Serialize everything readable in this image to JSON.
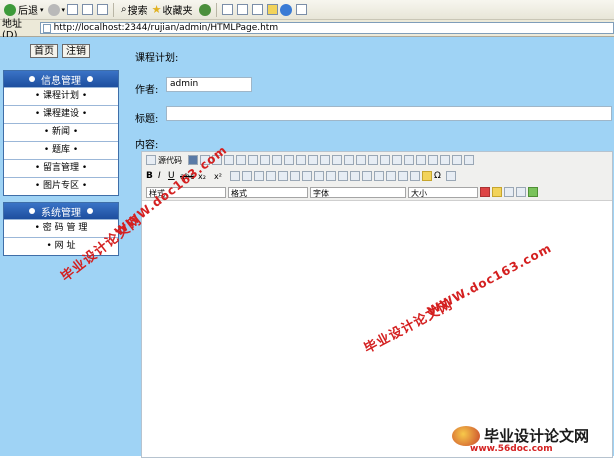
{
  "browser": {
    "toolbar": {
      "back_label": "后退",
      "search_label": "搜索",
      "favorites_label": "收藏夹"
    },
    "address": {
      "label": "地址(D)",
      "url": "http://localhost:2344/rujian/admin/HTMLPage.htm"
    }
  },
  "sidebar": {
    "home_button": "首页",
    "logout_button": "注销",
    "info_menu": {
      "title": "信息管理",
      "items": [
        "• 课程计划 •",
        "• 课程建设 •",
        "• 新闻 •",
        "• 题库 •",
        "• 留言管理 •",
        "• 图片专区 •"
      ]
    },
    "system_menu": {
      "title": "系统管理",
      "items": [
        "• 密 码 管 理",
        "• 网 址"
      ]
    }
  },
  "form": {
    "section_title": "课程计划:",
    "author_label": "作者:",
    "author_value": "admin",
    "title_label": "标题:",
    "title_value": "",
    "content_label": "内容:"
  },
  "editor": {
    "source_label": "源代码",
    "style_label": "样式",
    "format_label": "格式",
    "font_label": "字体",
    "size_label": "大小",
    "bold": "B",
    "italic": "I",
    "underline": "U",
    "strike": "abc",
    "subscript": "x₂",
    "superscript": "x²"
  },
  "watermarks": {
    "site": "WWW.doc163.com",
    "name": "毕业设计论文网"
  },
  "footer_logo": {
    "name": "毕业设计论文网",
    "url": "www.56doc.com"
  },
  "colors": {
    "panel_bg": "#9fd3f5",
    "menu_header": "#1d4e9e",
    "watermark": "#d42020"
  }
}
